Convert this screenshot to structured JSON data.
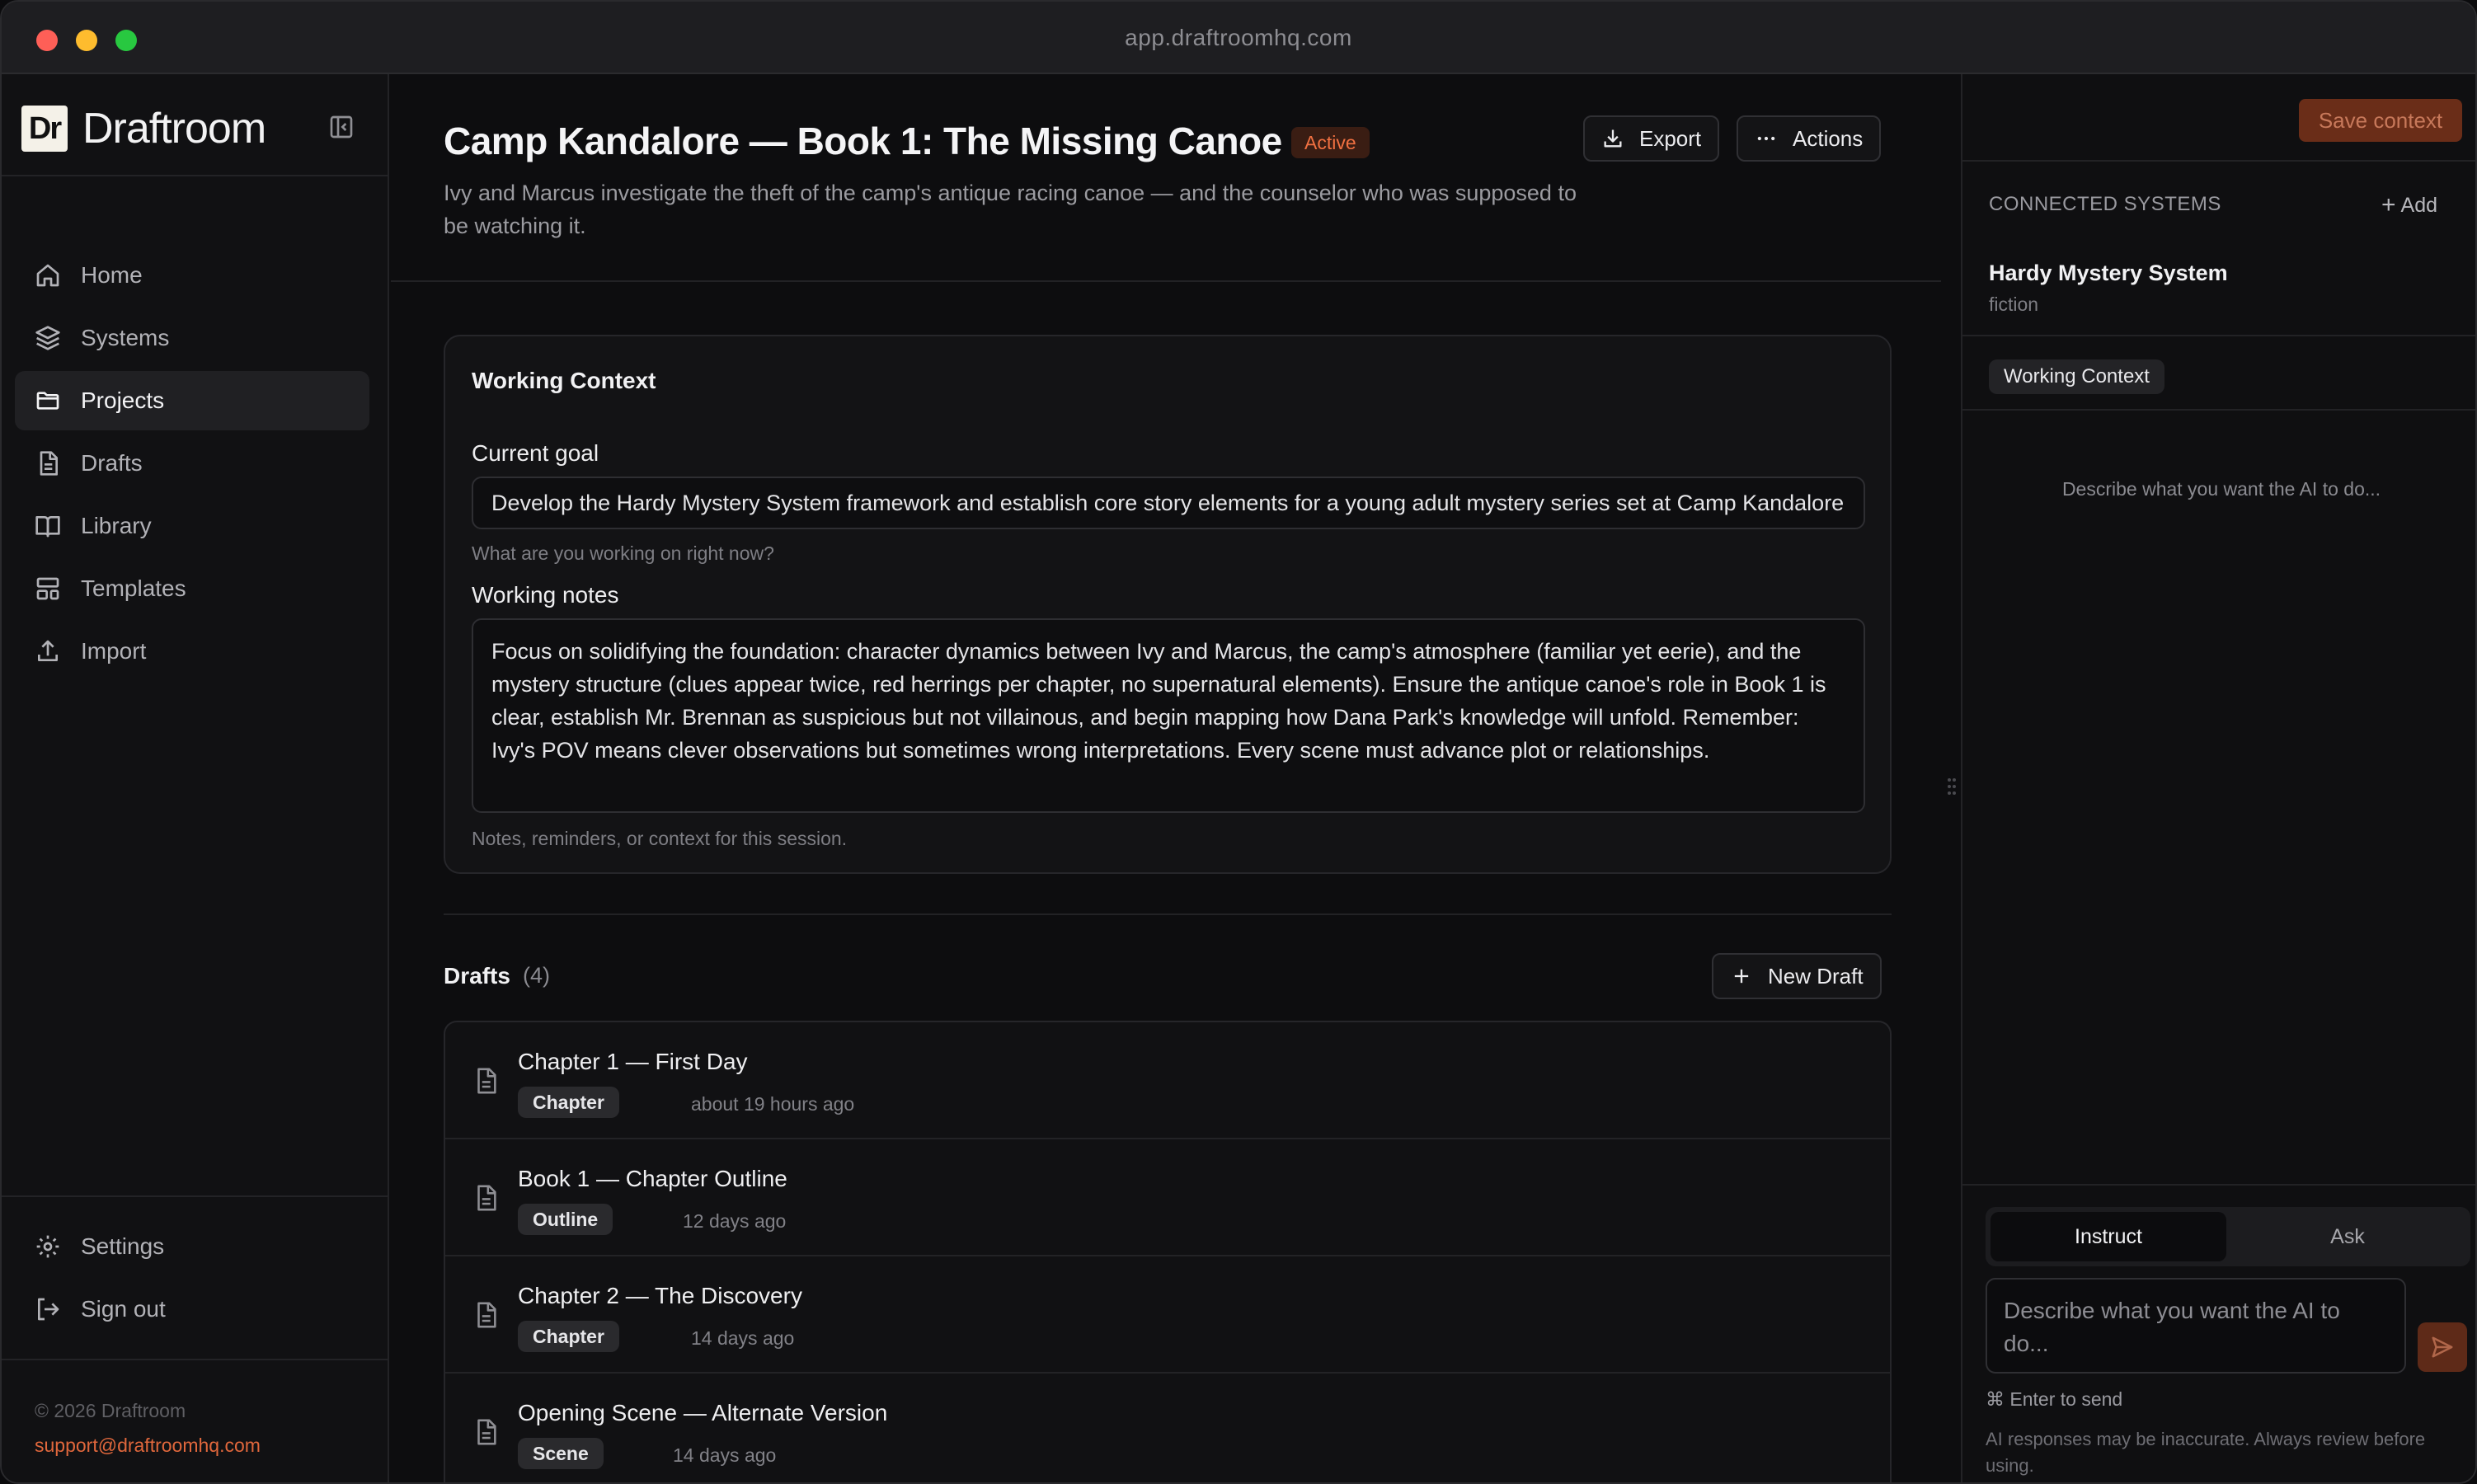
{
  "browser": {
    "url": "app.draftroomhq.com"
  },
  "sidebar": {
    "logo_text": "Dr",
    "brand": "Draftroom",
    "nav": [
      {
        "label": "Home",
        "icon": "home-icon"
      },
      {
        "label": "Systems",
        "icon": "layers-icon"
      },
      {
        "label": "Projects",
        "icon": "folder-icon",
        "active": true
      },
      {
        "label": "Drafts",
        "icon": "document-icon"
      },
      {
        "label": "Library",
        "icon": "book-icon"
      },
      {
        "label": "Templates",
        "icon": "layout-icon"
      },
      {
        "label": "Import",
        "icon": "upload-icon"
      }
    ],
    "bottom": [
      {
        "label": "Settings",
        "icon": "gear-icon"
      },
      {
        "label": "Sign out",
        "icon": "sign-out-icon"
      }
    ],
    "copyright": "© 2026 Draftroom",
    "support_email": "support@draftroomhq.com"
  },
  "project": {
    "title": "Camp Kandalore — Book 1: The Missing Canoe",
    "status": "Active",
    "description": "Ivy and Marcus investigate the theft of the camp's antique racing canoe — and the counselor who was supposed to be watching it.",
    "export_label": "Export",
    "actions_label": "Actions"
  },
  "working_context": {
    "title": "Working Context",
    "goal_label": "Current goal",
    "goal_value": "Develop the Hardy Mystery System framework and establish core story elements for a young adult mystery series set at Camp Kandalore",
    "goal_hint": "What are you working on right now?",
    "notes_label": "Working notes",
    "notes_value": "Focus on solidifying the foundation: character dynamics between Ivy and Marcus, the camp's atmosphere (familiar yet eerie), and the mystery structure (clues appear twice, red herrings per chapter, no supernatural elements). Ensure the antique canoe's role in Book 1 is clear, establish Mr. Brennan as suspicious but not villainous, and begin mapping how Dana Park's knowledge will unfold. Remember: Ivy's POV means clever observations but sometimes wrong interpretations. Every scene must advance plot or relationships.",
    "notes_hint": "Notes, reminders, or context for this session."
  },
  "drafts": {
    "heading": "Drafts",
    "count": "(4)",
    "new_label": "New Draft",
    "items": [
      {
        "title": "Chapter 1 — First Day",
        "tag": "Chapter",
        "time": "about 19 hours ago"
      },
      {
        "title": "Book 1 — Chapter Outline",
        "tag": "Outline",
        "time": "12 days ago"
      },
      {
        "title": "Chapter 2 — The Discovery",
        "tag": "Chapter",
        "time": "14 days ago"
      },
      {
        "title": "Opening Scene — Alternate Version",
        "tag": "Scene",
        "time": "14 days ago"
      }
    ]
  },
  "right_panel": {
    "save_label": "Save context",
    "connected_heading": "CONNECTED SYSTEMS",
    "add_label": "Add",
    "system_name": "Hardy Mystery System",
    "system_type": "fiction",
    "context_chip": "Working Context",
    "empty_placeholder": "Describe what you want the AI to do...",
    "mode_instruct": "Instruct",
    "mode_ask": "Ask",
    "input_placeholder": "Describe what you want the AI to do...",
    "send_hint": "⌘ Enter to send",
    "disclaimer": "AI responses may be inaccurate. Always review before using."
  },
  "colors": {
    "accent": "#e0673c",
    "background": "#0d0d0f",
    "sidebar": "#111113"
  }
}
